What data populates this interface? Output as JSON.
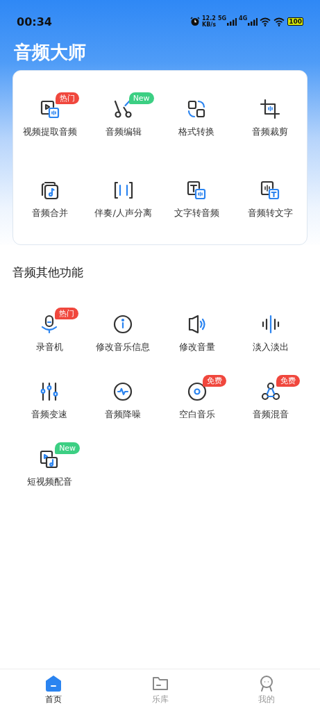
{
  "status_bar": {
    "time": "00:34",
    "speed": "12.2",
    "speed_unit": "KB/s",
    "networks": [
      "5G",
      "4G"
    ],
    "battery": "100"
  },
  "app_title": "音频大师",
  "main_tools": [
    {
      "label": "视频提取音频",
      "kind": "video-audio",
      "badge": {
        "text": "热门",
        "color": "#f0473d"
      }
    },
    {
      "label": "音频编辑",
      "kind": "scissors",
      "badge": {
        "text": "New",
        "color": "#3ccf83"
      }
    },
    {
      "label": "格式转换",
      "kind": "shapes"
    },
    {
      "label": "音频裁剪",
      "kind": "crop"
    },
    {
      "label": "音频合并",
      "kind": "music-file"
    },
    {
      "label": "伴奏/人声分离",
      "kind": "brackets"
    },
    {
      "label": "文字转音频",
      "kind": "text-audio"
    },
    {
      "label": "音频转文字",
      "kind": "audio-text"
    }
  ],
  "section_title": "音频其他功能",
  "other_tools": [
    {
      "label": "录音机",
      "kind": "microphone",
      "badge": {
        "text": "热门",
        "color": "#f0473d"
      }
    },
    {
      "label": "修改音乐信息",
      "kind": "info"
    },
    {
      "label": "修改音量",
      "kind": "speaker"
    },
    {
      "label": "淡入淡出",
      "kind": "waveform"
    },
    {
      "label": "音频变速",
      "kind": "sliders"
    },
    {
      "label": "音频降噪",
      "kind": "pulse"
    },
    {
      "label": "空白音乐",
      "kind": "disc",
      "badge": {
        "text": "免费",
        "color": "#f0473d"
      }
    },
    {
      "label": "音频混音",
      "kind": "nodes",
      "badge": {
        "text": "免费",
        "color": "#f0473d"
      }
    },
    {
      "label": "短视频配音",
      "kind": "video-music",
      "badge": {
        "text": "New",
        "color": "#3ccf83"
      }
    }
  ],
  "tabs": [
    {
      "label": "首页",
      "kind": "home",
      "selected": true
    },
    {
      "label": "乐库",
      "kind": "folder",
      "selected": false
    },
    {
      "label": "我的",
      "kind": "robot",
      "selected": false
    }
  ]
}
